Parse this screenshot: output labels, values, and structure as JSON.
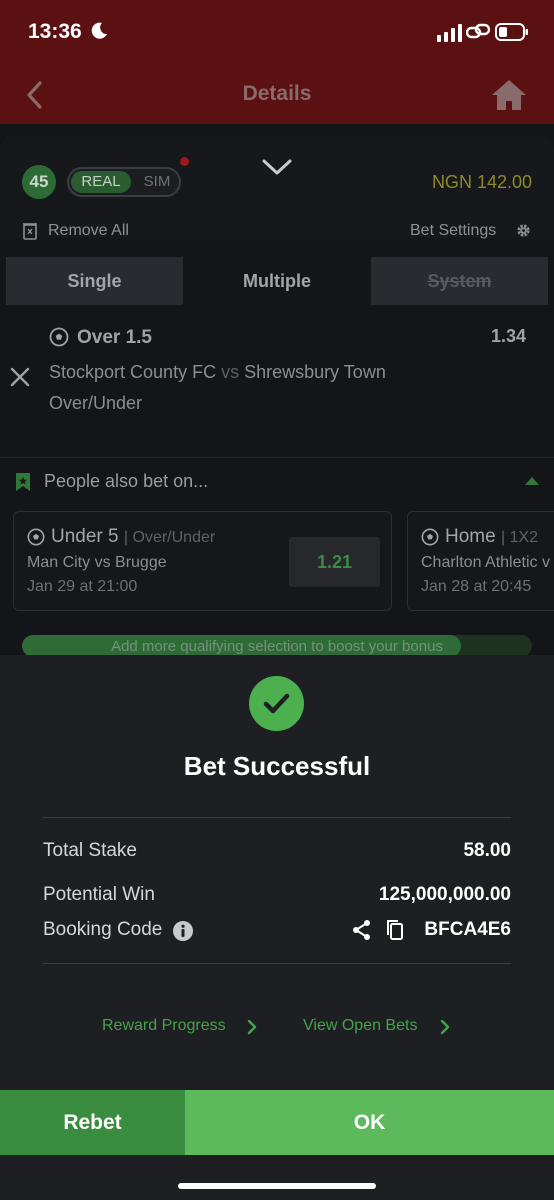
{
  "status_bar": {
    "time": "13:36"
  },
  "header": {
    "title": "Details"
  },
  "betslip": {
    "selection_count": "45",
    "mode_toggle": {
      "real_label": "REAL",
      "sim_label": "SIM",
      "selected": "REAL"
    },
    "balance": "NGN 142.00",
    "remove_all_label": "Remove All",
    "bet_settings_label": "Bet Settings",
    "tabs": [
      {
        "label": "Single"
      },
      {
        "label": "Multiple",
        "active": true
      },
      {
        "label": "System",
        "disabled": true
      }
    ],
    "selection": {
      "market_pick": "Over 1.5",
      "odds": "1.34",
      "home_team": "Stockport County FC",
      "vs": "vs",
      "away_team": "Shrewsbury Town",
      "market_type": "Over/Under"
    },
    "people_also_bet": {
      "title": "People also bet on...",
      "cards": [
        {
          "pick": "Under 5",
          "market": "Over/Under",
          "teams": "Man City vs Brugge",
          "time": "Jan 29 at 21:00",
          "odds": "1.21"
        },
        {
          "pick": "Home",
          "market": "1X2",
          "teams": "Charlton Athletic v",
          "time": "Jan 28 at 20:45"
        }
      ]
    },
    "boost_bar": {
      "text": "Add more qualifying selection to boost your bonus",
      "progress": 0.86
    }
  },
  "success_sheet": {
    "title": "Bet Successful",
    "total_stake_label": "Total Stake",
    "total_stake": "58.00",
    "potential_win_label": "Potential Win",
    "potential_win": "125,000,000.00",
    "booking_code_label": "Booking Code",
    "booking_code": "BFCA4E6",
    "reward_progress_label": "Reward Progress",
    "view_open_bets_label": "View Open Bets",
    "rebet_label": "Rebet",
    "ok_label": "OK"
  },
  "colors": {
    "accent_green": "#5cba5c",
    "header_red": "#5b1111",
    "balance_yellow": "#8c8a2b"
  },
  "icons": [
    "moon-icon",
    "cellular-signal-icon",
    "link-icon",
    "battery-icon",
    "back-arrow-icon",
    "home-icon",
    "chevron-down-icon",
    "trash-icon",
    "gear-icon",
    "soccer-ball-icon",
    "close-icon",
    "bookmark-icon",
    "caret-up-icon",
    "checkmark-icon",
    "info-icon",
    "share-icon",
    "copy-icon",
    "chevron-right-icon"
  ]
}
